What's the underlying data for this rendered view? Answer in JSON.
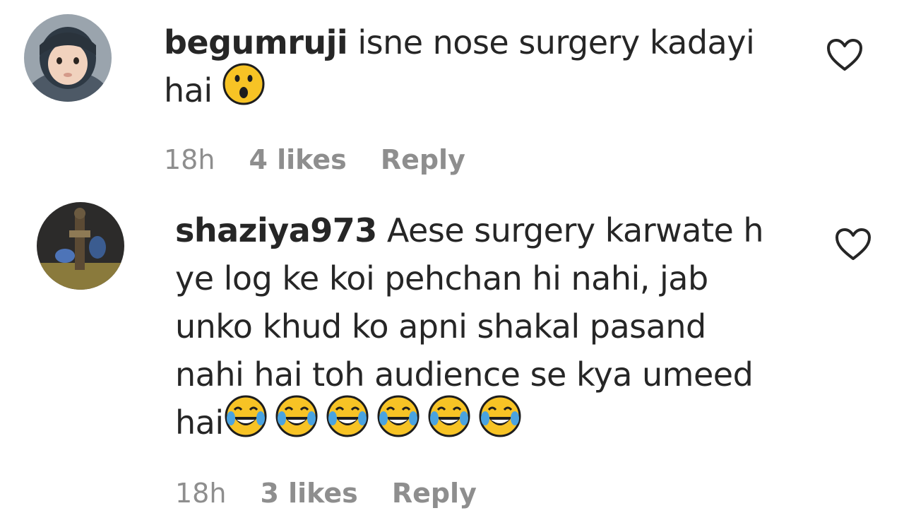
{
  "comments": [
    {
      "username": "begumruji",
      "text_line1": " isne nose surgery kadayi",
      "text_line2": "hai",
      "emoji": "astonished-face",
      "time": "18h",
      "likes": "4 likes",
      "reply": "Reply"
    },
    {
      "username": "shaziya973",
      "text_line1": " Aese surgery karwate h",
      "text_line2": "ye log ke koi pehchan hi nahi, jab",
      "text_line3": "unko khud ko apni shakal pasand",
      "text_line4": "nahi hai toh audience se kya umeed",
      "text_line5": "hai",
      "emoji": "face-with-tears-of-joy",
      "emoji_count": 6,
      "time": "18h",
      "likes": "3 likes",
      "reply": "Reply"
    }
  ],
  "icons": {
    "like": "heart-icon"
  },
  "colors": {
    "text": "#262626",
    "meta": "#8e8e8e",
    "emoji_face": "#f7c325"
  }
}
